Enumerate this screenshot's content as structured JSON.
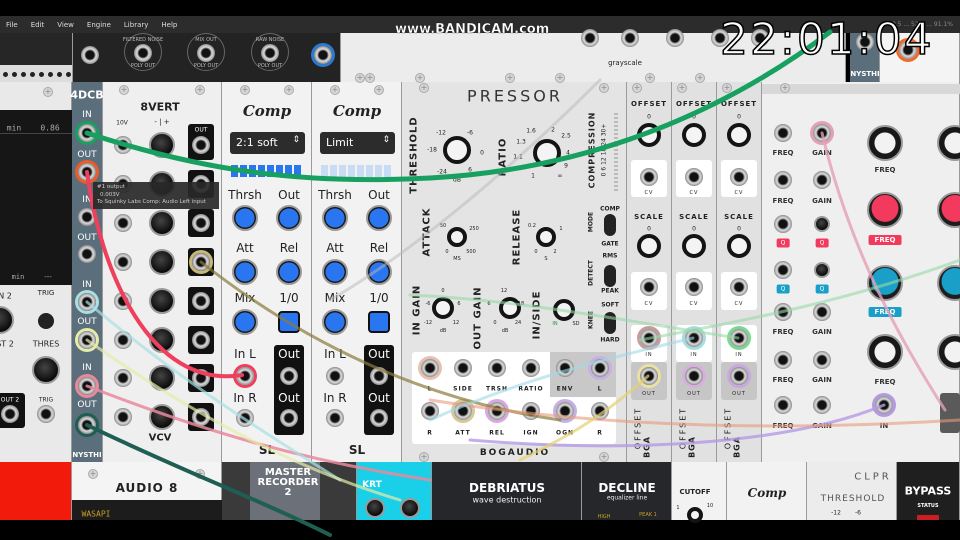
{
  "menu": [
    "File",
    "Edit",
    "View",
    "Engine",
    "Library",
    "Help"
  ],
  "overlay": {
    "watermark": "www.BANDICAM.com",
    "clock": "22:01:04"
  },
  "top_row": {
    "noise_labels": [
      "FILTERED NOISE",
      "MIX OUT",
      "RAW NOISE"
    ],
    "poly_out": "POLY OUT",
    "grayscale": "grayscale",
    "nysthi": "NYSTHI",
    "stats": "70.5 ... 52.6 ... 91.1%"
  },
  "left_module": {
    "display_label": "min",
    "display_value": "0.86",
    "display_label2": "min",
    "display_value2": "---",
    "labels": [
      "N 2",
      "TRIG",
      "ST 2",
      "THRES",
      "OUT 2",
      "TRIG"
    ]
  },
  "dcb": {
    "title": "4DCB",
    "in": "IN",
    "out": "OUT",
    "brand": "NYSTHI"
  },
  "eightvert": {
    "title": "8VERT",
    "v10": "10V",
    "polarity": "- | +",
    "out": "OUT",
    "brand": "VCV"
  },
  "comp": {
    "logo": "Comp",
    "labels": {
      "thrsh": "Thrsh",
      "out": "Out",
      "att": "Att",
      "rel": "Rel",
      "mix": "Mix",
      "onoff": "1/0",
      "inl": "In L",
      "inr": "In R"
    },
    "brand": "SL",
    "modes": [
      "2:1 soft",
      "Limit"
    ]
  },
  "pressor": {
    "title": "PRESSOR",
    "brand": "BOGAUDIO",
    "threshold": "THRESHOLD",
    "threshold_scale": [
      "-12",
      "-6",
      "-18",
      "0",
      "-24",
      "6"
    ],
    "db": "dB",
    "ratio": "RATIO",
    "ratio_scale": [
      "1.6",
      "2",
      "1.3",
      "2.5",
      "1.1",
      "4",
      "1",
      "∞",
      "9"
    ],
    "compression": "COMPRESSION",
    "compression_scale": "0  6  12  18  24  30+",
    "attack": "ATTACK",
    "attack_scale": [
      "50",
      "250",
      "0",
      "500"
    ],
    "ms": "MS",
    "release": "RELEASE",
    "release_scale": [
      "0.2",
      "1",
      "0",
      "2"
    ],
    "s": "S",
    "mode": "MODE",
    "comp": "COMP",
    "gate": "GATE",
    "detect": "DETECT",
    "rms": "RMS",
    "peak": "PEAK",
    "knee": "KNEE",
    "soft": "SOFT",
    "hard": "HARD",
    "in_gain": "IN GAIN",
    "in_gain_scale": [
      "0",
      "-6",
      "6",
      "-12",
      "12"
    ],
    "out_gain": "OUT GAIN",
    "out_gain_scale": [
      "12",
      "6",
      "18",
      "0",
      "24"
    ],
    "in_side": "IN/SIDE",
    "in_side_scale": [
      "IN",
      "SD"
    ],
    "jacks_row1": [
      "L",
      "SIDE",
      "TRSH",
      "RATIO",
      "ENV",
      "L"
    ],
    "jacks_row2": [
      "R",
      "ATT",
      "REL",
      "IGN",
      "OGN",
      "R"
    ]
  },
  "offset": {
    "offset": "OFFSET",
    "scale": "SCALE",
    "cv": "CV",
    "in": "IN",
    "out": "OUT",
    "zero": "0",
    "brand": "BGA"
  },
  "eq": {
    "freq": "FREQ",
    "gain": "GAIN",
    "q": "Q",
    "in": "IN"
  },
  "tooltip": {
    "line1": "#1 output",
    "line2": "0.003V",
    "line3": "To Squinky Labs Comp: Audio Left input"
  },
  "bottom_row": {
    "audio": "AUDIO 8",
    "driver": "WASAPI",
    "recorder": "MASTER RECORDER 2",
    "krt": "KRT",
    "debriatus": "DEBRIATUS",
    "debriatus_sub": "wave destruction",
    "decline": "DECLINE",
    "decline_sub": "equalizer line",
    "decline_high": "HIGH",
    "decline_peak": "PEAK 1",
    "cutoff": "CUTOFF",
    "cutoff_scale": [
      "1",
      "10"
    ],
    "comp": "Comp",
    "clpr": "CLPR",
    "threshold": "THRESHOLD",
    "threshold_scale": [
      "-12",
      "-6"
    ],
    "bypass": "BYPASS",
    "status": "STATUS"
  },
  "colors": {
    "cable_green": "#17a060",
    "cable_red": "#ee3f5c",
    "dcb_panel": "#5a6e7c",
    "comp_blue": "#2a76f0",
    "eq_red": "#f23a5e",
    "eq_blue": "#1aa0c8"
  }
}
